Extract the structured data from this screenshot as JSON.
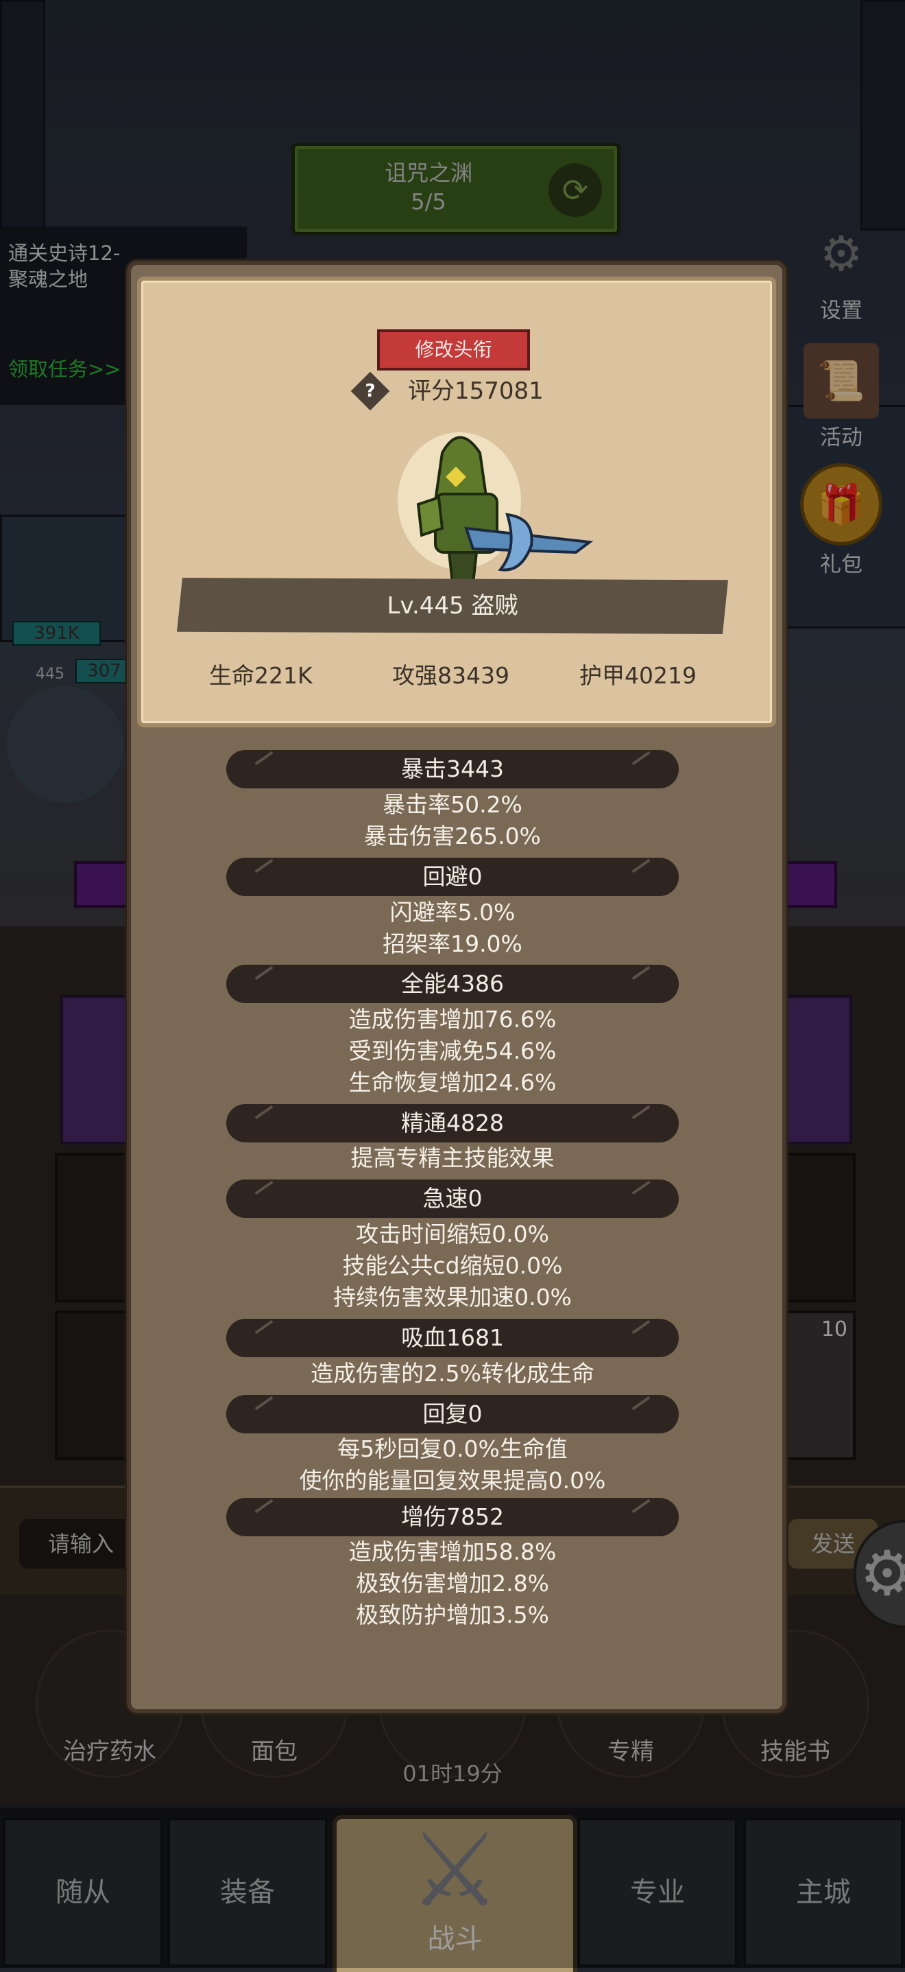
{
  "scene": {
    "dungeon": {
      "name": "诅咒之渊",
      "progress": "5/5"
    },
    "quest": {
      "title": "通关史诗12-聚魂之地",
      "claim": "领取任务>>"
    },
    "side_buttons": [
      {
        "label": "设置",
        "icon": "gear-icon"
      },
      {
        "label": "活动",
        "icon": "scroll-icon"
      },
      {
        "label": "礼包",
        "icon": "gift-icon"
      }
    ],
    "left_unit": {
      "hp1": "391K",
      "level": "445",
      "hp2": "307"
    },
    "slot_badge": "10"
  },
  "chat": {
    "placeholder": "请输入",
    "send": "发送"
  },
  "consumables": [
    {
      "label": "治疗药水"
    },
    {
      "label": "面包"
    },
    {
      "label": ""
    },
    {
      "label": "专精"
    },
    {
      "label": "技能书"
    }
  ],
  "timer": "01时19分",
  "nav": {
    "tabs": [
      "随从",
      "装备",
      "专业",
      "主城"
    ],
    "battle": "战斗"
  },
  "panel": {
    "title_button": "修改头衔",
    "score": "评分157081",
    "level": "Lv.445 盗贼",
    "base_stats": {
      "hp": "生命221K",
      "atk": "攻强83439",
      "armor": "护甲40219"
    },
    "sections": [
      {
        "header": "暴击3443",
        "lines": [
          "暴击率50.2%",
          "暴击伤害265.0%"
        ]
      },
      {
        "header": "回避0",
        "lines": [
          "闪避率5.0%",
          "招架率19.0%"
        ]
      },
      {
        "header": "全能4386",
        "lines": [
          "造成伤害增加76.6%",
          "受到伤害减免54.6%",
          "生命恢复增加24.6%"
        ]
      },
      {
        "header": "精通4828",
        "lines": [
          "提高专精主技能效果"
        ]
      },
      {
        "header": "急速0",
        "lines": [
          "攻击时间缩短0.0%",
          "技能公共cd缩短0.0%",
          "持续伤害效果加速0.0%"
        ]
      },
      {
        "header": "吸血1681",
        "lines": [
          "造成伤害的2.5%转化成生命"
        ]
      },
      {
        "header": "回复0",
        "lines": [
          "每5秒回复0.0%生命值",
          "使你的能量回复效果提高0.0%"
        ]
      },
      {
        "header": "增伤7852",
        "lines": [
          "造成伤害增加58.8%",
          "极致伤害增加2.8%",
          "极致防护增加3.5%"
        ]
      }
    ]
  }
}
